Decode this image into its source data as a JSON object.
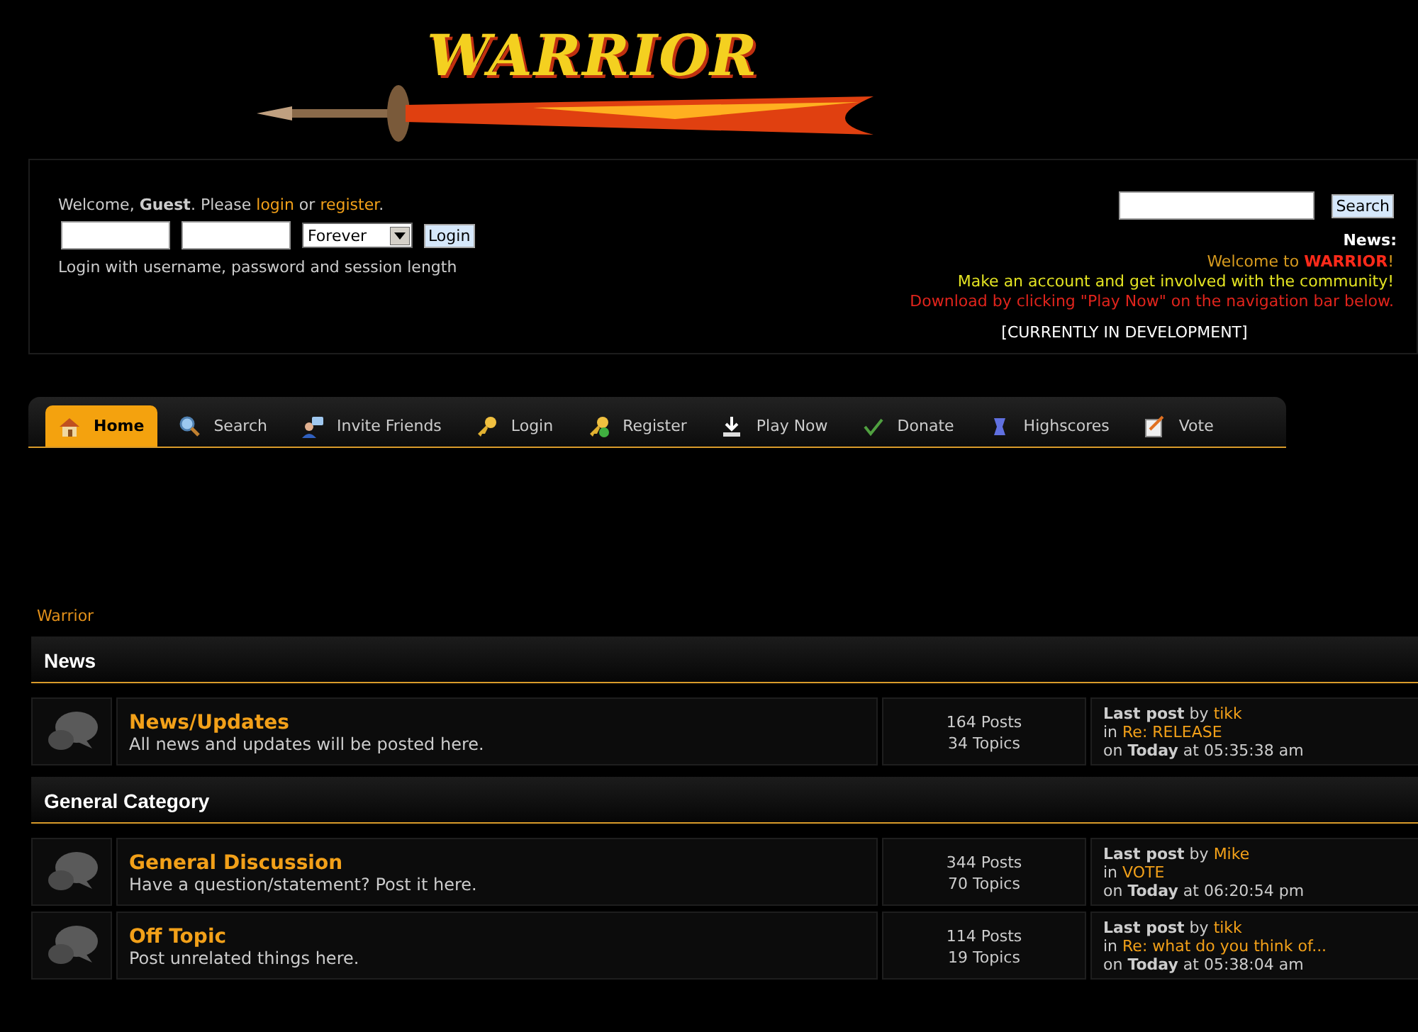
{
  "logo": {
    "text": "WARRIOR"
  },
  "login": {
    "greeting": [
      {
        "kind": "text",
        "text": "Welcome, **Guest**. Please "
      },
      {
        "kind": "link",
        "text": "login"
      },
      {
        "kind": "text",
        "text": " or "
      },
      {
        "kind": "link",
        "text": "register"
      },
      {
        "kind": "text",
        "text": "."
      }
    ],
    "session": "Forever",
    "button": "Login",
    "hint": "Login with username, password and session length"
  },
  "search": {
    "button": "Search"
  },
  "news": {
    "heading": "News:",
    "lines": [
      {
        "segments": [
          {
            "text": "Welcome to ",
            "color": "#d69a1e"
          },
          {
            "text": "**WARRIOR**",
            "color": "#ff2a1a"
          },
          {
            "text": "!",
            "color": "#d69a1e"
          }
        ]
      },
      {
        "segments": [
          {
            "text": "Make an account and get involved with the community!",
            "color": "#e3e322"
          }
        ]
      },
      {
        "segments": [
          {
            "text": "Download by clicking \"Play Now\" on the navigation bar below.",
            "color": "#e0241c"
          }
        ]
      }
    ],
    "note": "[CURRENTLY IN DEVELOPMENT]"
  },
  "nav": [
    {
      "label": "Home",
      "selected": true
    },
    {
      "label": "Search",
      "selected": false
    },
    {
      "label": "Invite Friends",
      "selected": false
    },
    {
      "label": "Login",
      "selected": false
    },
    {
      "label": "Register",
      "selected": false
    },
    {
      "label": "Play Now",
      "selected": false
    },
    {
      "label": "Donate",
      "selected": false
    },
    {
      "label": "Highscores",
      "selected": false
    },
    {
      "label": "Vote",
      "selected": false
    }
  ],
  "breadcrumb": "Warrior",
  "categories": [
    {
      "title": "News",
      "boards": [
        {
          "name": "News/Updates",
          "description": "All news and updates will be posted here.",
          "posts": "164 Posts",
          "topics": "34 Topics",
          "by_line": "**Last post** by",
          "author": "tikk",
          "in_label": "in",
          "topic": "Re: RELEASE",
          "time": "on **Today** at 05:35:38 am"
        }
      ]
    },
    {
      "title": "General Category",
      "boards": [
        {
          "name": "General Discussion",
          "description": "Have a question/statement? Post it here.",
          "posts": "344 Posts",
          "topics": "70 Topics",
          "by_line": "**Last post** by",
          "author": "Mike",
          "in_label": "in",
          "topic": "VOTE",
          "time": "on **Today** at 06:20:54 pm"
        },
        {
          "name": "Off Topic",
          "description": "Post unrelated things here.",
          "posts": "114 Posts",
          "topics": "19 Topics",
          "by_line": "**Last post** by",
          "author": "tikk",
          "in_label": "in",
          "topic": "Re: what do you think of...",
          "time": "on **Today** at 05:38:04 am"
        }
      ]
    }
  ]
}
